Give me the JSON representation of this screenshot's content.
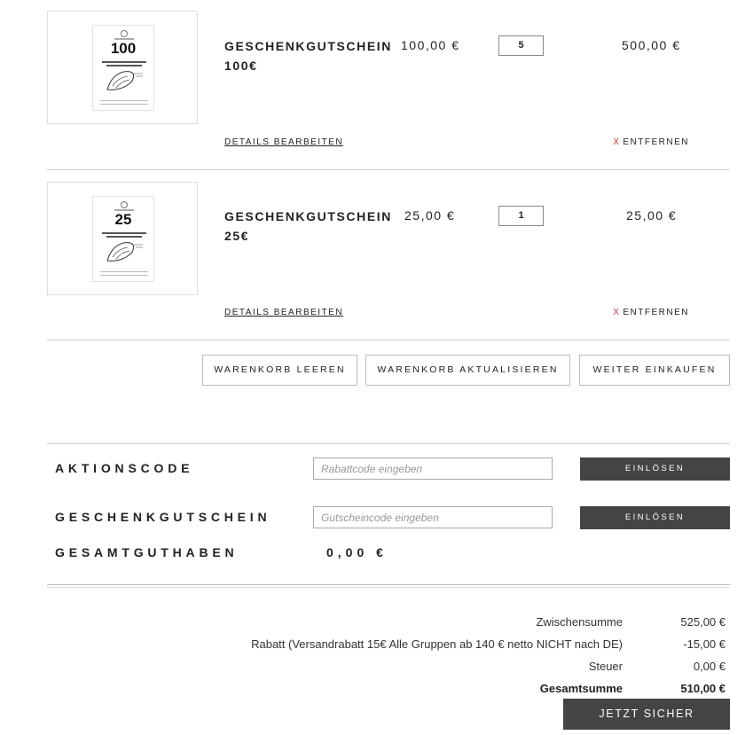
{
  "cart": {
    "items": [
      {
        "name_line1": "GESCHENKGUTSCHEIN",
        "name_line2": "100€",
        "card_value": "100",
        "price": "100,00 €",
        "qty": "5",
        "subtotal": "500,00 €",
        "edit_label": "DETAILS BEARBEITEN",
        "remove_x": "X",
        "remove_label": "ENTFERNEN"
      },
      {
        "name_line1": "GESCHENKGUTSCHEIN",
        "name_line2": "25€",
        "card_value": "25",
        "price": "25,00 €",
        "qty": "1",
        "subtotal": "25,00 €",
        "edit_label": "DETAILS BEARBEITEN",
        "remove_x": "X",
        "remove_label": "ENTFERNEN"
      }
    ],
    "actions": {
      "clear_label": "WARENKORB LEEREN",
      "update_label": "WARENKORB AKTUALISIEREN",
      "continue_label": "WEITER EINKAUFEN"
    }
  },
  "promo": {
    "label": "AKTIONSCODE",
    "placeholder": "Rabattcode eingeben",
    "button_label": "EINLÖSEN"
  },
  "giftcard": {
    "label": "GESCHENKGUTSCHEIN",
    "placeholder": "Gutscheincode eingeben",
    "button_label": "EINLÖSEN",
    "balance_label": "GESAMTGUTHABEN",
    "balance_value": "0,00 €"
  },
  "totals": {
    "subtotal_label": "Zwischensumme",
    "subtotal_value": "525,00 €",
    "discount_label": "Rabatt (Versandrabatt 15€ Alle Gruppen ab 140 € netto NICHT nach DE)",
    "discount_value": "-15,00 €",
    "tax_label": "Steuer",
    "tax_value": "0,00 €",
    "grand_label": "Gesamtsumme",
    "grand_value": "510,00 €"
  },
  "checkout": {
    "pay_label": "JETZT SICHER BEZAHLEN"
  },
  "colors": {
    "dark_button": "#444444",
    "remove_x": "#c0392b",
    "divider": "#cccccc"
  }
}
